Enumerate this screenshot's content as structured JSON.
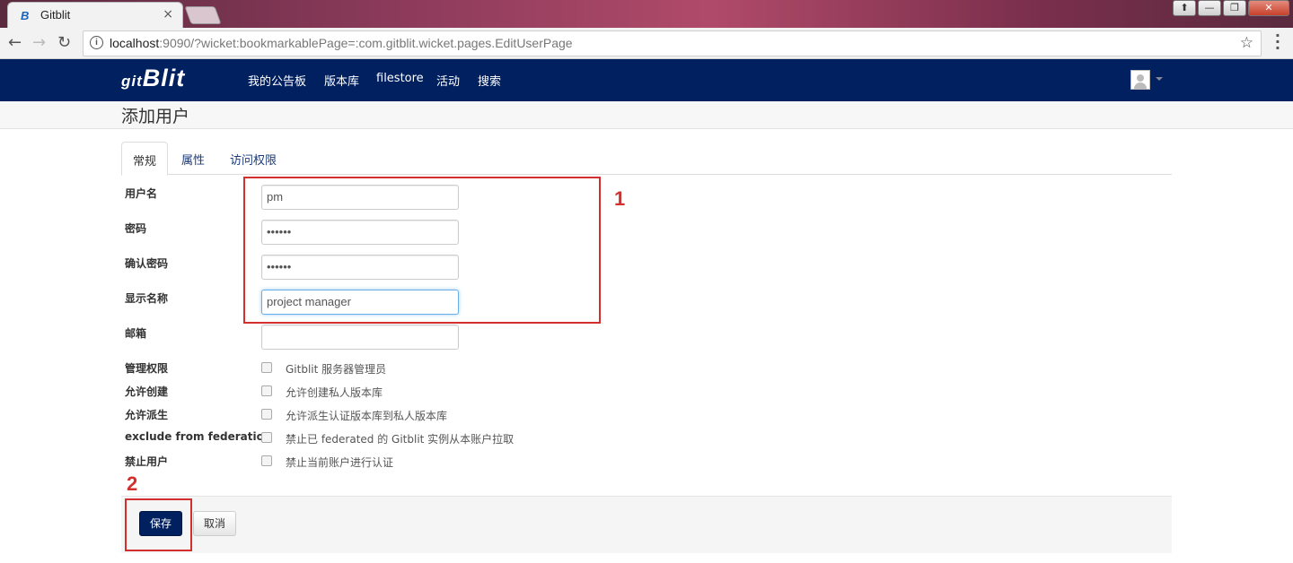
{
  "browser": {
    "tab_icon": "B",
    "tab_title": "Gitblit",
    "tab_close": "×",
    "url_host": "localhost",
    "url_rest": ":9090/?wicket:bookmarkablePage=:com.gitblit.wicket.pages.EditUserPage",
    "window_buttons": [
      "⬆",
      "—",
      "❐",
      "✕"
    ]
  },
  "navbar": {
    "logo_prefix": "git",
    "logo": "Blit",
    "items": [
      "我的公告板",
      "版本库",
      "filestore",
      "活动",
      "搜索"
    ]
  },
  "page_title": "添加用户",
  "tabs": [
    "常规",
    "属性",
    "访问权限"
  ],
  "form": {
    "fields": [
      {
        "label": "用户名",
        "value": "pm"
      },
      {
        "label": "密码",
        "value": "••••••"
      },
      {
        "label": "确认密码",
        "value": "••••••"
      },
      {
        "label": "显示名称",
        "value": "project manager"
      },
      {
        "label": "邮箱",
        "value": ""
      }
    ],
    "checkboxes": [
      {
        "label": "管理权限",
        "text": "Gitblit 服务器管理员",
        "checked": false
      },
      {
        "label": "允许创建",
        "text": "允许创建私人版本库",
        "checked": false
      },
      {
        "label": "允许派生",
        "text": "允许派生认证版本库到私人版本库",
        "checked": false
      },
      {
        "label": "exclude from federation",
        "text": "禁止已 federated 的 Gitblit 实例从本账户拉取",
        "checked": false
      },
      {
        "label": "禁止用户",
        "text": "禁止当前账户进行认证",
        "checked": false
      }
    ]
  },
  "annotations": [
    "1",
    "2"
  ],
  "buttons": {
    "save": "保存",
    "cancel": "取消"
  },
  "colors": {
    "navbar": "#002060",
    "annotation": "#d32f2f",
    "accent": "#66afe9"
  }
}
